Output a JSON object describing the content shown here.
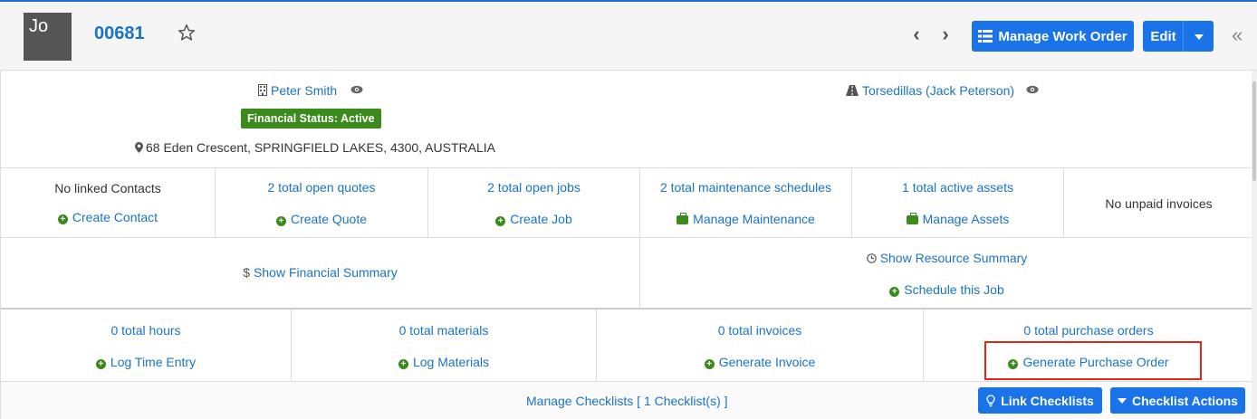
{
  "header": {
    "avatar_text": "Jo",
    "work_order_number": "00681",
    "manage_button": "Manage Work Order",
    "edit_button": "Edit"
  },
  "client": {
    "name": "Peter Smith",
    "financial_status": "Financial Status: Active",
    "address": "68 Eden Crescent, SPRINGFIELD LAKES, 4300, AUSTRALIA",
    "site": "Torsedillas (Jack Peterson)"
  },
  "summary_row": [
    {
      "text": "No linked Contacts",
      "action": "Create Contact"
    },
    {
      "text": "2 total open quotes",
      "action": "Create Quote"
    },
    {
      "text": "2 total open jobs",
      "action": "Create Job"
    },
    {
      "text": "2 total maintenance schedules",
      "action": "Manage Maintenance"
    },
    {
      "text": "1 total active assets",
      "action": "Manage Assets"
    },
    {
      "text": "No unpaid invoices"
    }
  ],
  "financial": {
    "show_financial": "Show Financial Summary",
    "show_resource": "Show Resource Summary",
    "schedule": "Schedule this Job"
  },
  "totals_row": [
    {
      "text": "0 total hours",
      "action": "Log Time Entry"
    },
    {
      "text": "0 total materials",
      "action": "Log Materials"
    },
    {
      "text": "0 total invoices",
      "action": "Generate Invoice"
    },
    {
      "text": "0 total purchase orders",
      "action": "Generate Purchase Order"
    }
  ],
  "checklists": {
    "manage_text": "Manage Checklists [ 1 Checklist(s) ]",
    "link_button": "Link Checklists",
    "actions_button": "Checklist Actions"
  },
  "colors": {
    "primary": "#1a73e8",
    "link": "#1a73c7",
    "success": "#3a8a1c",
    "highlight": "#e0261a"
  }
}
